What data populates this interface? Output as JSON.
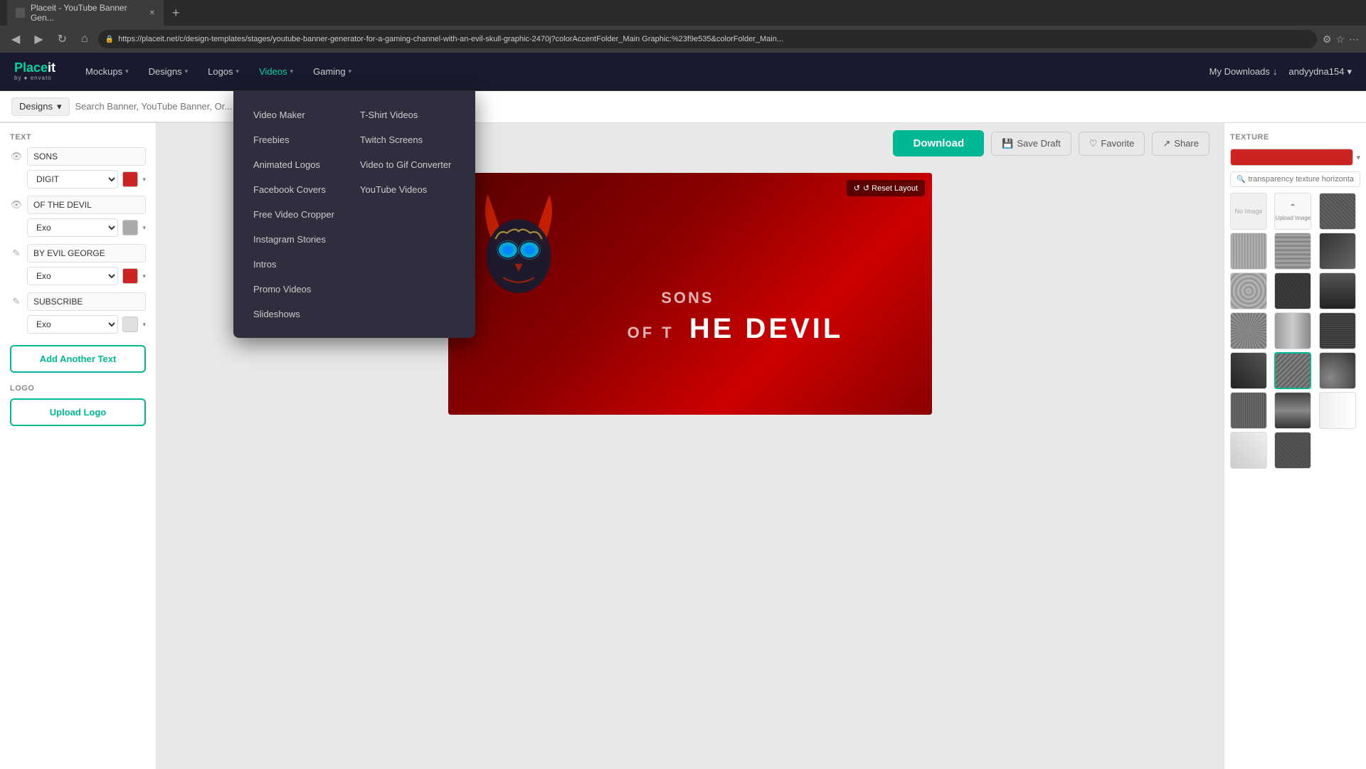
{
  "browser": {
    "tab_title": "Placeit - YouTube Banner Gen...",
    "url": "https://placeit.net/c/design-templates/stages/youtube-banner-generator-for-a-gaming-channel-with-an-evil-skull-graphic-2470j?colorAccentFolder_Main Graphic:%23f9e535&colorFolder_Main...",
    "back_btn": "◀",
    "forward_btn": "▶",
    "refresh_btn": "↻",
    "home_btn": "⌂"
  },
  "header": {
    "logo_place": "Place",
    "logo_it": "it",
    "logo_by": "by ● envato",
    "nav": [
      {
        "label": "Mockups",
        "has_dropdown": true
      },
      {
        "label": "Designs",
        "has_dropdown": true
      },
      {
        "label": "Logos",
        "has_dropdown": true
      },
      {
        "label": "Videos",
        "has_dropdown": true,
        "active": true
      },
      {
        "label": "Gaming",
        "has_dropdown": true
      }
    ],
    "my_downloads": "My Downloads",
    "user": "andyydna154"
  },
  "search": {
    "selector_label": "Designs",
    "placeholder": "Search Banner, YouTube Banner, Or...",
    "search_icon": "🔍"
  },
  "left_panel": {
    "text_section_label": "Text",
    "text_rows": [
      {
        "value": "SONS",
        "visible": true,
        "font": "DIGIT",
        "color": "red"
      },
      {
        "value": "OF THE DEVIL",
        "visible": true,
        "font": "Exo",
        "color": "gray"
      },
      {
        "value": "BY EVIL GEORGE",
        "visible": true,
        "font": "Exo",
        "color": "red"
      },
      {
        "value": "SUBSCRIBE",
        "visible": true,
        "font": "Exo",
        "color": "white"
      }
    ],
    "add_text_btn": "Add Another Text",
    "logo_section_label": "Logo",
    "upload_logo_btn": "Upload Logo"
  },
  "canvas": {
    "reset_layout_btn": "↺ Reset Layout",
    "download_btn": "Download",
    "save_draft_btn": "Save Draft",
    "favorite_btn": "Favorite",
    "share_btn": "Share",
    "banner_text_sons": "SONS",
    "banner_text_devil": "HE DEVIL"
  },
  "right_panel": {
    "texture_label": "Texture",
    "search_placeholder": "transparency texture horizonta",
    "texture_items": [
      "no-image",
      "upload",
      "t1",
      "t2",
      "t3",
      "t4",
      "t5",
      "t6",
      "t7",
      "t8",
      "t9",
      "t10",
      "t11",
      "t12",
      "t13",
      "t14",
      "t15",
      "t16",
      "t17",
      "t18"
    ]
  },
  "videos_dropdown": {
    "col1": [
      "Video Maker",
      "Freebies",
      "Animated Logos",
      "Facebook Covers",
      "Free Video Cropper",
      "Instagram Stories",
      "Intros",
      "Promo Videos",
      "Slideshows"
    ],
    "col2": [
      "T-Shirt Videos",
      "Twitch Screens",
      "Video to Gif Converter",
      "YouTube Videos"
    ]
  }
}
